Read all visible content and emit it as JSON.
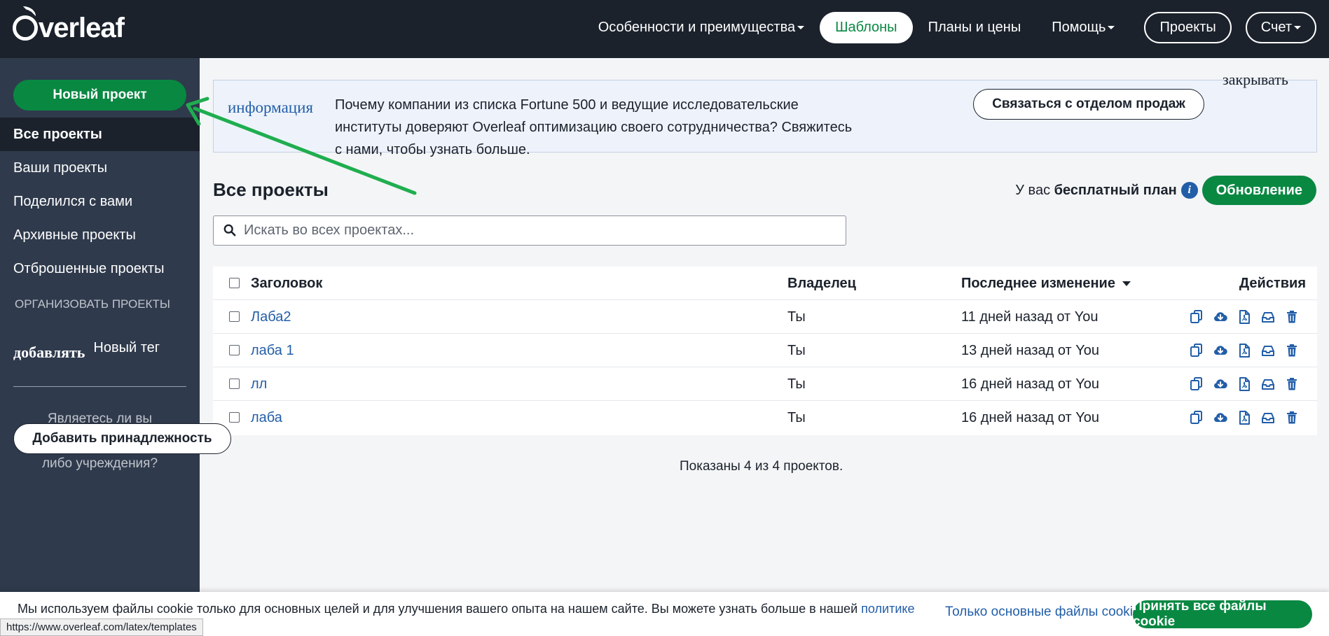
{
  "navbar": {
    "logo": "Overleaf",
    "features": "Особенности и преимущества",
    "templates": "Шаблоны",
    "plans": "Планы и цены",
    "help": "Помощь",
    "projects": "Проекты",
    "account": "Счет"
  },
  "sidebar": {
    "new_project": "Новый проект",
    "items": [
      {
        "label": "Все проекты",
        "active": true
      },
      {
        "label": "Ваши проекты"
      },
      {
        "label": "Поделился с вами"
      },
      {
        "label": "Архивные проекты"
      },
      {
        "label": "Отброшенные проекты"
      }
    ],
    "organize_heading": "ОРГАНИЗОВАТЬ ПРОЕКТЫ",
    "add_label": "добавлять",
    "new_tag_label": "Новый тег",
    "affiliation_question": "Являетесь ли вы представителем какого-либо учреждения?",
    "add_affiliation": "Добавить принадлежность"
  },
  "banner": {
    "icon_text": "информация",
    "text": "Почему компании из списка Fortune 500 и ведущие исследовательские институты доверяют Overleaf оптимизацию своего сотрудничества? Свяжитесь с нами, чтобы узнать больше.",
    "contact_sales": "Связаться с отделом продаж",
    "close": "закрывать"
  },
  "main": {
    "title": "Все проекты",
    "plan_prefix": "У вас",
    "plan_name": "бесплатный план",
    "info_icon": "i",
    "upgrade": "Обновление",
    "search_placeholder": "Искать во всех проектах...",
    "shown": "Показаны 4 из 4 проектов."
  },
  "table": {
    "headers": {
      "title": "Заголовок",
      "owner": "Владелец",
      "modified": "Последнее изменение",
      "actions": "Действия"
    },
    "rows": [
      {
        "title": "Лаба2",
        "owner": "Ты",
        "modified": "11 дней назад от You"
      },
      {
        "title": "лаба 1",
        "owner": "Ты",
        "modified": "13 дней назад от You"
      },
      {
        "title": "лл",
        "owner": "Ты",
        "modified": "16 дней назад от You"
      },
      {
        "title": "лаба",
        "owner": "Ты",
        "modified": "16 дней назад от You"
      }
    ],
    "action_icons": [
      "copy-icon",
      "download-icon",
      "pdf-icon",
      "archive-icon",
      "trash-icon"
    ]
  },
  "cookie": {
    "text": "Мы используем файлы cookie только для основных целей и для улучшения вашего опыта на нашем сайте. Вы можете узнать больше в нашей",
    "policy_link": "политике",
    "essential_only": "Только основные файлы cookie",
    "accept_all": "Принять все файлы cookie"
  },
  "status_url": "https://www.overleaf.com/latex/templates",
  "colors": {
    "navbar_bg": "#1b222c",
    "sidebar_bg": "#2f3a4c",
    "accent_green": "#098842",
    "link_blue": "#225ea8",
    "annotation_arrow": "#1fae4f"
  }
}
